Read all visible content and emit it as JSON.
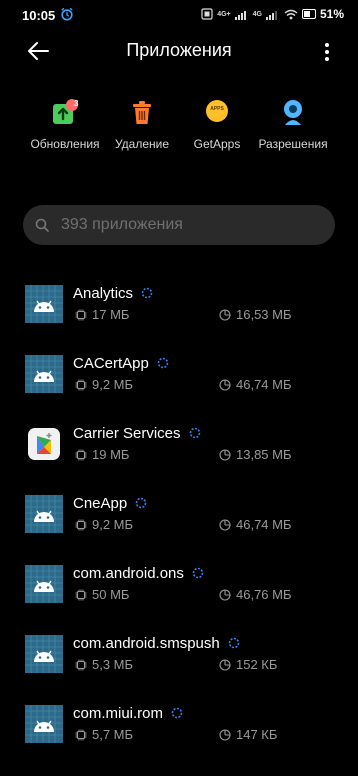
{
  "status_bar": {
    "time": "10:05",
    "alarm_icon": "alarm-clock-icon",
    "network_labels": [
      "4G+",
      "4G"
    ],
    "battery_percent": "51%"
  },
  "header": {
    "title": "Приложения",
    "back_icon": "arrow-left-icon",
    "more_icon": "more-vertical-icon"
  },
  "actions": [
    {
      "label": "Обновления",
      "icon": "updates-icon",
      "badge": "3",
      "color": "#4ccc5a"
    },
    {
      "label": "Удаление",
      "icon": "trash-icon",
      "color": "#ff7a2f"
    },
    {
      "label": "GetApps",
      "icon": "getapps-icon",
      "icon_text": "APPS",
      "color": "#ffbf2a"
    },
    {
      "label": "Разрешения",
      "icon": "permissions-icon",
      "color": "#4fb6ff"
    }
  ],
  "search": {
    "placeholder": "393 приложения"
  },
  "apps": [
    {
      "name": "Analytics",
      "size": "17 МБ",
      "cache": "16,53 МБ",
      "icon": "android-icon"
    },
    {
      "name": "CACertApp",
      "size": "9,2 МБ",
      "cache": "46,74 МБ",
      "icon": "android-icon"
    },
    {
      "name": "Carrier Services",
      "size": "19 МБ",
      "cache": "13,85 МБ",
      "icon": "carrier-services-icon"
    },
    {
      "name": "CneApp",
      "size": "9,2 МБ",
      "cache": "46,74 МБ",
      "icon": "android-icon"
    },
    {
      "name": "com.android.ons",
      "size": "50 МБ",
      "cache": "46,76 МБ",
      "icon": "android-icon"
    },
    {
      "name": "com.android.smspush",
      "size": "5,3 МБ",
      "cache": "152 КБ",
      "icon": "android-icon"
    },
    {
      "name": "com.miui.rom",
      "size": "5,7 МБ",
      "cache": "147 КБ",
      "icon": "android-icon"
    }
  ],
  "colors": {
    "background": "#000000",
    "secondary_text": "#9a9a9a",
    "search_bg": "#2a2a2a",
    "loading_accent": "#3b82f6"
  }
}
